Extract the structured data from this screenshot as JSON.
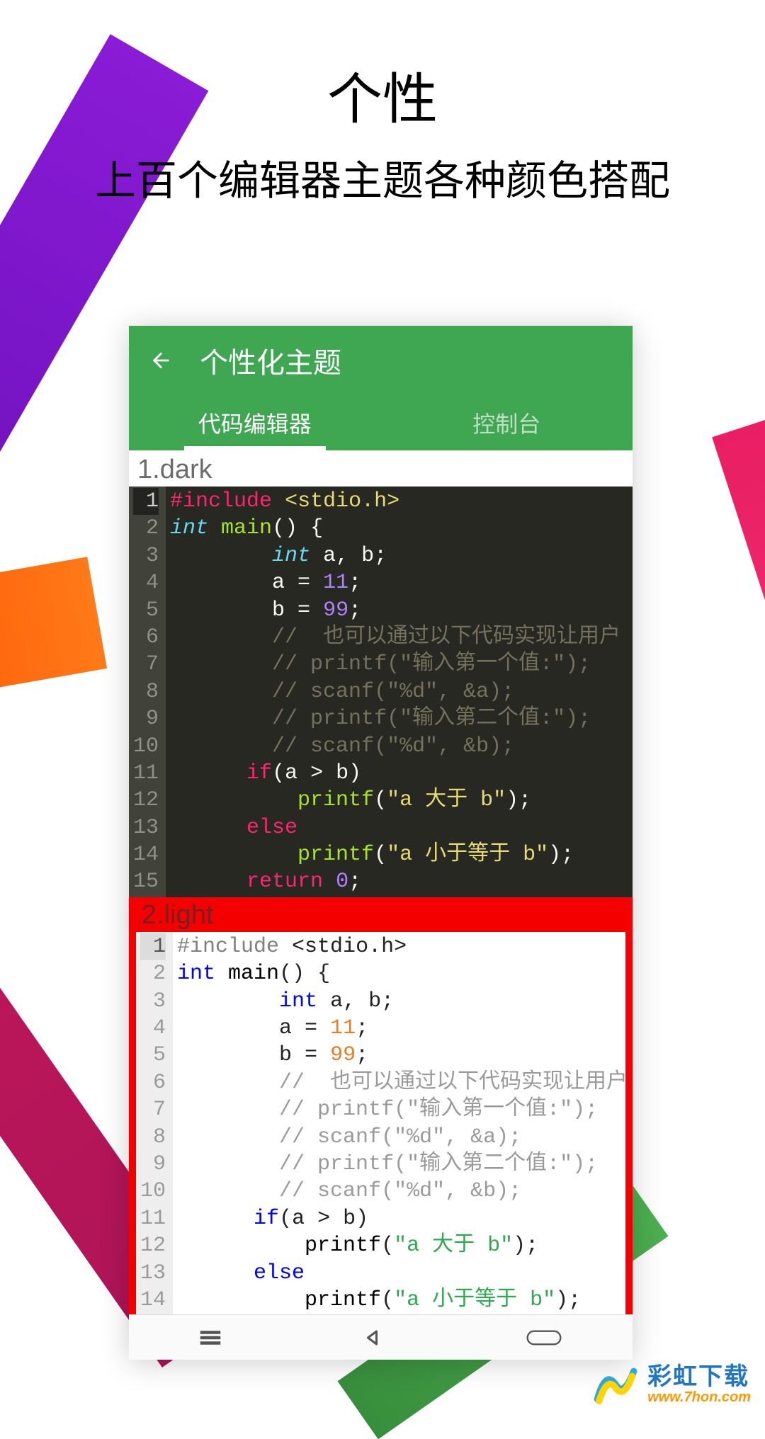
{
  "promo": {
    "title": "个性",
    "subtitle": "上百个编辑器主题各种颜色搭配"
  },
  "app": {
    "screen_title": "个性化主题",
    "tabs": [
      "代码编辑器",
      "控制台"
    ],
    "active_tab_index": 0
  },
  "themes": [
    {
      "label": "1.dark",
      "mode": "dark",
      "selected": false
    },
    {
      "label": "2.light",
      "mode": "light",
      "selected": true
    }
  ],
  "code_lines": [
    {
      "n": 1,
      "t": "preproc",
      "raw": "#include <stdio.h>"
    },
    {
      "n": 2,
      "t": "decl",
      "raw": "int main() {"
    },
    {
      "n": 3,
      "t": "decl2",
      "raw": "        int a, b;"
    },
    {
      "n": 4,
      "t": "assign",
      "raw": "        a = 11;",
      "num": "11"
    },
    {
      "n": 5,
      "t": "assign",
      "raw": "        b = 99;",
      "num": "99"
    },
    {
      "n": 6,
      "t": "comment",
      "raw": "        //  也可以通过以下代码实现让用户"
    },
    {
      "n": 7,
      "t": "comment",
      "raw": "        // printf(\"输入第一个值:\");"
    },
    {
      "n": 8,
      "t": "comment",
      "raw": "        // scanf(\"%d\", &a);"
    },
    {
      "n": 9,
      "t": "comment",
      "raw": "        // printf(\"输入第二个值:\");"
    },
    {
      "n": 10,
      "t": "comment",
      "raw": "        // scanf(\"%d\", &b);"
    },
    {
      "n": 11,
      "t": "if",
      "raw": "      if(a > b)"
    },
    {
      "n": 12,
      "t": "call",
      "raw": "          printf(\"a 大于 b\");",
      "str": "\"a 大于 b\""
    },
    {
      "n": 13,
      "t": "else",
      "raw": "      else"
    },
    {
      "n": 14,
      "t": "call",
      "raw": "          printf(\"a 小于等于 b\");",
      "str": "\"a 小于等于 b\""
    },
    {
      "n": 15,
      "t": "return",
      "raw": "      return 0;"
    }
  ],
  "brand": {
    "name_cn": "彩虹下载",
    "name_en": "www.7hon.com"
  },
  "colors": {
    "header_green": "#3fa652",
    "selection_red": "#f40000"
  }
}
